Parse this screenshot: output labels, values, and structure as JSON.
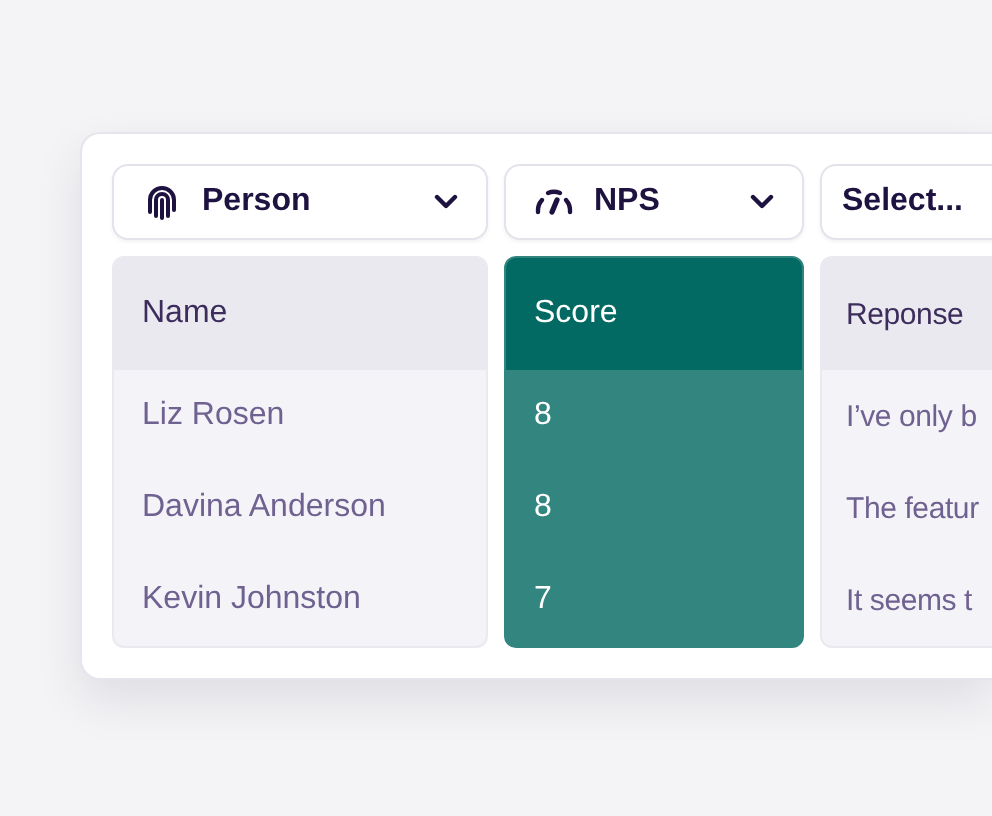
{
  "columns": [
    {
      "selector": {
        "value": "Person"
      },
      "header": "Name",
      "selected": false,
      "cells": [
        "Liz Rosen",
        "Davina Anderson",
        "Kevin Johnston"
      ]
    },
    {
      "selector": {
        "value": "NPS"
      },
      "header": "Score",
      "selected": true,
      "cells": [
        "8",
        "8",
        "7"
      ]
    },
    {
      "selector": {
        "placeholder": "Select..."
      },
      "header": "Reponse",
      "selected": false,
      "cells": [
        "I’ve only b",
        "The featur",
        "It seems t"
      ]
    }
  ]
}
